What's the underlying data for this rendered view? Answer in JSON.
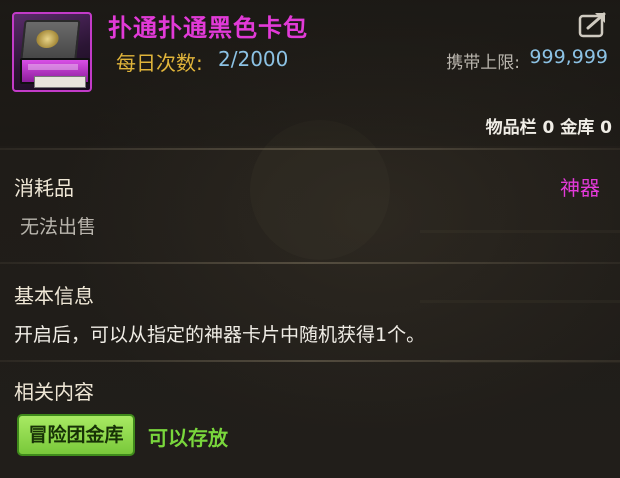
{
  "item": {
    "name": "扑通扑通黑色卡包",
    "daily_label": "每日次数:",
    "daily_value": "2/2000",
    "carry_label": "携带上限:",
    "carry_value": "999,999",
    "storage": "物品栏 0 金库 0",
    "icon": "card-pack-icon"
  },
  "header": {
    "share_icon": "share-export-icon"
  },
  "category": {
    "label": "消耗品",
    "type": "神器",
    "sell_status": "无法出售"
  },
  "info": {
    "label": "基本信息",
    "description": "开启后，可以从指定的神器卡片中随机获得1个。"
  },
  "related": {
    "label": "相关内容",
    "vault_button": "冒险团金库",
    "storable": "可以存放"
  },
  "colors": {
    "title": "#e23ad8",
    "daily_label": "#e0b43a",
    "value_blue": "#8cc2e4",
    "type": "#e23ad8",
    "vault_button_bg": "#8fd94f",
    "storable": "#79d63c"
  }
}
